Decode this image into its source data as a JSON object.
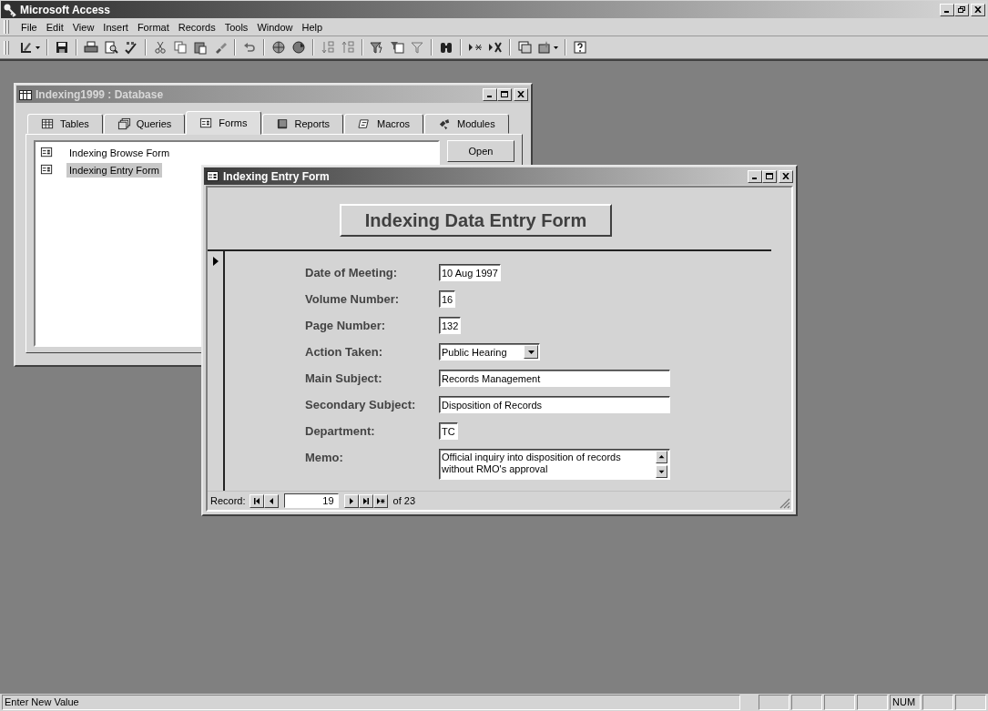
{
  "app": {
    "title": "Microsoft Access"
  },
  "menu": [
    "File",
    "Edit",
    "View",
    "Insert",
    "Format",
    "Records",
    "Tools",
    "Window",
    "Help"
  ],
  "database_window": {
    "title": "Indexing1999 : Database",
    "tabs": [
      {
        "label": "Tables",
        "selected": false
      },
      {
        "label": "Queries",
        "selected": false
      },
      {
        "label": "Forms",
        "selected": true
      },
      {
        "label": "Reports",
        "selected": false
      },
      {
        "label": "Macros",
        "selected": false
      },
      {
        "label": "Modules",
        "selected": false
      }
    ],
    "objects": [
      {
        "label": "Indexing Browse Form",
        "selected": false
      },
      {
        "label": "Indexing Entry Form",
        "selected": true
      }
    ],
    "buttons": [
      "Open"
    ]
  },
  "form_window": {
    "title": "Indexing Entry Form",
    "heading": "Indexing Data Entry Form",
    "fields": [
      {
        "label": "Date of Meeting:",
        "kind": "text",
        "value": "10 Aug 1997"
      },
      {
        "label": "Volume Number:",
        "kind": "text",
        "value": "16"
      },
      {
        "label": "Page Number:",
        "kind": "text",
        "value": "132"
      },
      {
        "label": "Action Taken:",
        "kind": "combo",
        "value": "Public Hearing"
      },
      {
        "label": "Main Subject:",
        "kind": "wide",
        "value": "Records Management"
      },
      {
        "label": "Secondary Subject:",
        "kind": "wide",
        "value": "Disposition of Records"
      },
      {
        "label": "Department:",
        "kind": "text",
        "value": "TC"
      },
      {
        "label": "Memo:",
        "kind": "memo",
        "value": "Official inquiry into disposition of records without RMO's approval"
      }
    ],
    "navigation": {
      "label": "Record:",
      "current": "19",
      "total": "of 23"
    }
  },
  "status_bar": {
    "message": "Enter New Value",
    "indicator": "NUM"
  }
}
